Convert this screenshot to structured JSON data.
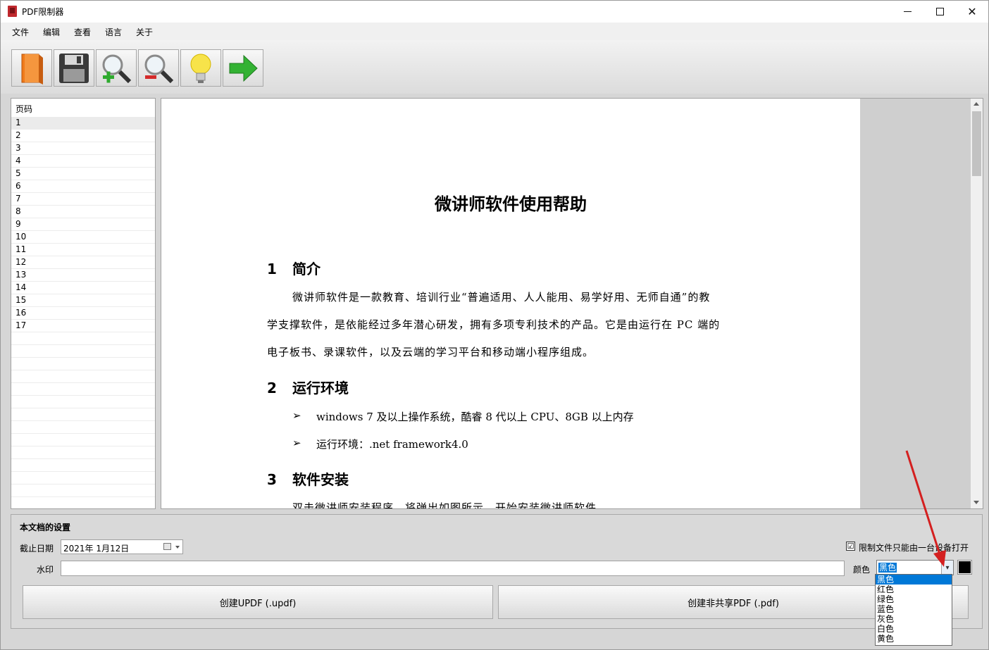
{
  "window": {
    "title": "PDF限制器"
  },
  "menu": [
    "文件",
    "编辑",
    "查看",
    "语言",
    "关于"
  ],
  "toolbar": [
    {
      "icon": "open-book-icon",
      "color": "#f07a1a"
    },
    {
      "icon": "save-disk-icon",
      "color": "#333333"
    },
    {
      "icon": "zoom-in-icon",
      "color": "#2eaa2e"
    },
    {
      "icon": "zoom-out-icon",
      "color": "#d42b2b"
    },
    {
      "icon": "lightbulb-icon",
      "color": "#f4d81a"
    },
    {
      "icon": "green-arrow-icon",
      "color": "#33b233"
    }
  ],
  "pagelist": {
    "header": "页码",
    "pages": [
      "1",
      "2",
      "3",
      "4",
      "5",
      "6",
      "7",
      "8",
      "9",
      "10",
      "11",
      "12",
      "13",
      "14",
      "15",
      "16",
      "17"
    ]
  },
  "document": {
    "title": "微讲师软件使用帮助",
    "s1_num": "1",
    "s1_title": "简介",
    "p1_l1": "微讲师软件是一款教育、培训行业“普遍适用、人人能用、易学好用、无师自通”的教",
    "p1_l2": "学支撑软件，是依能经过多年潜心研发，拥有多项专利技术的产品。它是由运行在 PC 端的",
    "p1_l3": "电子板书、录课软件，以及云端的学习平台和移动端小程序组成。",
    "s2_num": "2",
    "s2_title": "运行环境",
    "b1": "windows 7 及以上操作系统，酷睿 8 代以上 CPU、8GB 以上内存",
    "b2": "运行环境：.net framework4.0",
    "bullet_glyph": "➢",
    "s3_num": "3",
    "s3_title": "软件安装",
    "p3_partial": "双击微讲师安装程序，将弹出如图所示，开始安装微讲师软件。"
  },
  "settings": {
    "title": "本文档的设置",
    "expiry_label": "截止日期",
    "expiry_value": "2021年  1月12日",
    "watermark_label": "水印",
    "watermark_value": "",
    "restrict_label": "限制文件只能由一台设备打开",
    "restrict_checked": "☑",
    "color_label": "颜色",
    "color_value": "黑色",
    "swatch_color": "#000000",
    "btn_updf": "创建UPDF (.updf)",
    "btn_pdf": "创建非共享PDF (.pdf)"
  },
  "color_options": [
    "黑色",
    "红色",
    "绿色",
    "蓝色",
    "灰色",
    "白色",
    "黄色"
  ]
}
